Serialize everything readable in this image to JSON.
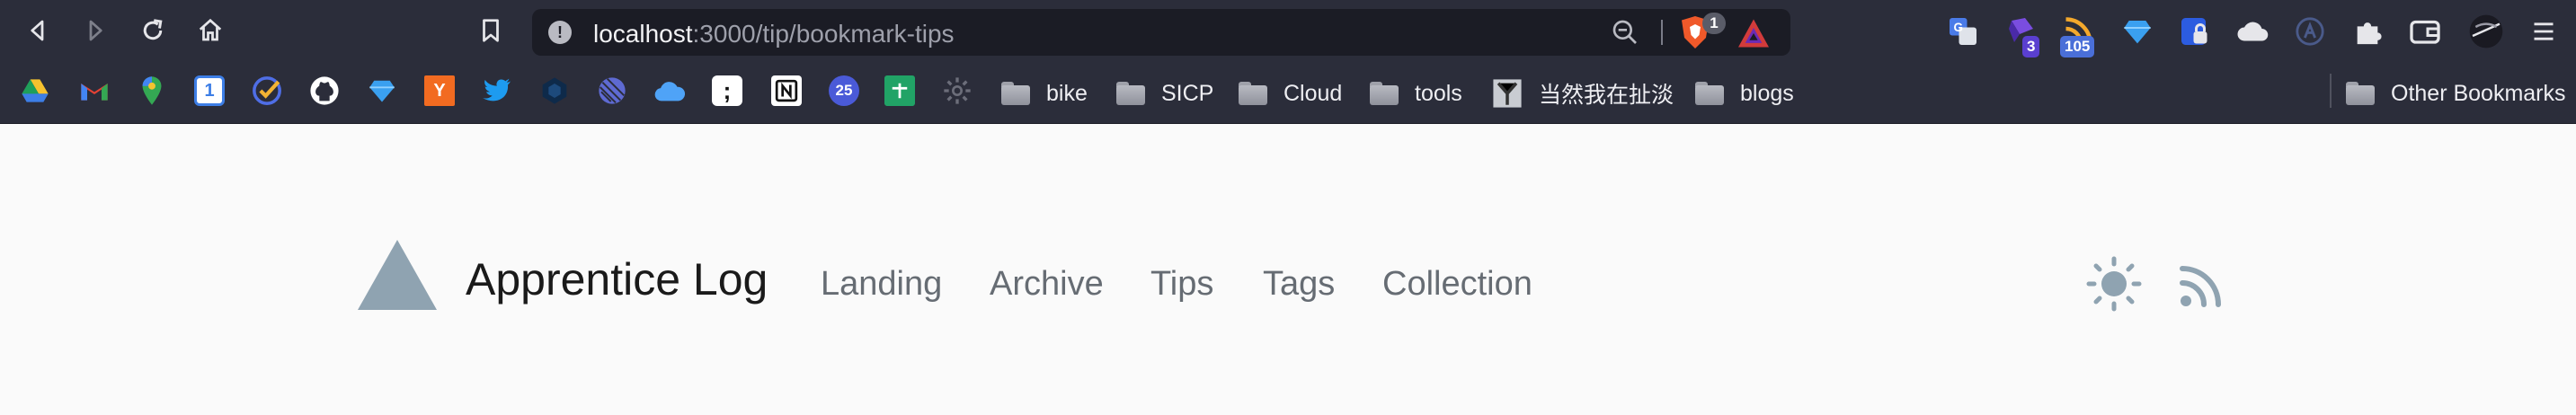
{
  "browser": {
    "url": {
      "host": "localhost",
      "path": ":3000/tip/bookmark-tips"
    },
    "shield_count": "1",
    "extensions": [
      {
        "icon": "translate-icon",
        "badge": ""
      },
      {
        "icon": "purple-extension-icon",
        "badge": "3"
      },
      {
        "icon": "rss-reader-icon",
        "badge": "105"
      },
      {
        "icon": "diamond-icon",
        "badge": ""
      },
      {
        "icon": "password-manager-icon",
        "badge": ""
      },
      {
        "icon": "cloud-icon",
        "badge": ""
      },
      {
        "icon": "circle-a-icon",
        "badge": ""
      },
      {
        "icon": "puzzle-icon",
        "badge": ""
      },
      {
        "icon": "wallet-icon",
        "badge": ""
      },
      {
        "icon": "profile-avatar-icon",
        "badge": ""
      },
      {
        "icon": "menu-icon",
        "badge": ""
      }
    ]
  },
  "bookmarks": {
    "icon_items": [
      "google-drive-icon",
      "gmail-icon",
      "google-maps-icon",
      "calendar-icon",
      "todo-check-icon",
      "github-icon",
      "diamond-icon",
      "hacker-news-icon",
      "twitter-icon",
      "dark-app-icon",
      "linear-icon",
      "cloud-icon",
      "semicolon-icon",
      "notion-icon",
      "calendar-25-icon",
      "sheets-icon",
      "settings-icon"
    ],
    "folders": [
      {
        "label": "bike"
      },
      {
        "label": "SICP"
      },
      {
        "label": "Cloud"
      },
      {
        "label": "tools"
      },
      {
        "label": "当然我在扯淡"
      },
      {
        "label": "blogs"
      }
    ],
    "other": "Other Bookmarks",
    "hn_letter": "Y",
    "calendar_num": "1",
    "cal25": "25",
    "semicolon": ";"
  },
  "site": {
    "title": "Apprentice Log",
    "nav": [
      "Landing",
      "Archive",
      "Tips",
      "Tags",
      "Collection"
    ],
    "logo_color": "#8fa3b1"
  }
}
